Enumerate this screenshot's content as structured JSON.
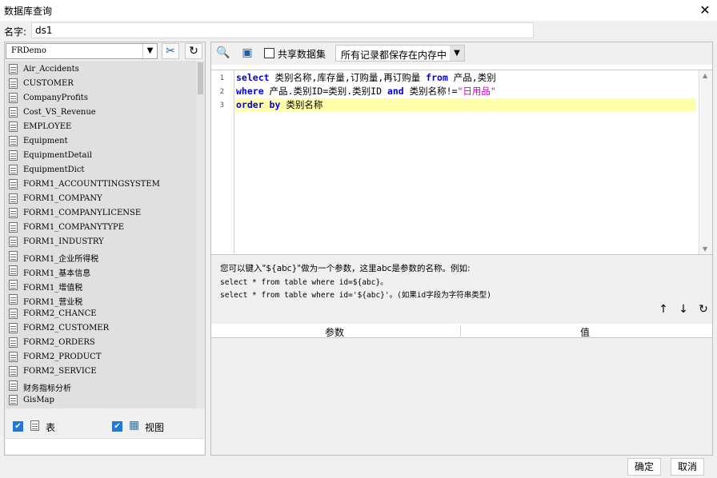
{
  "window": {
    "title": "数据库查询",
    "close_glyph": "✕"
  },
  "name_field": {
    "label": "名字:",
    "value": "ds1"
  },
  "left": {
    "db_select": "FRDemo",
    "tables": [
      "Air_Accidents",
      "CUSTOMER",
      "CompanyProfits",
      "Cost_VS_Revenue",
      "EMPLOYEE",
      "Equipment",
      "EquipmentDetail",
      "EquipmentDict",
      "FORM1_ACCOUNTTINGSYSTEM",
      "FORM1_COMPANY",
      "FORM1_COMPANYLICENSE",
      "FORM1_COMPANYTYPE",
      "FORM1_INDUSTRY",
      "FORM1_企业所得税",
      "FORM1_基本信息",
      "FORM1_增值税",
      "FORM1_营业税",
      "FORM2_CHANCE",
      "FORM2_CUSTOMER",
      "FORM2_ORDERS",
      "FORM2_PRODUCT",
      "FORM2_SERVICE",
      "财务指标分析",
      "GisMap"
    ],
    "check_table_label": "表",
    "check_view_label": "视图"
  },
  "toolbar": {
    "share_label": "共享数据集",
    "mem_select": "所有记录都保存在内存中"
  },
  "editor": {
    "lines": [
      {
        "num": "1",
        "parts": [
          [
            "kw",
            "select"
          ],
          [
            "t",
            " 类别名称,库存量,订购量,再订购量 "
          ],
          [
            "kw",
            "from"
          ],
          [
            "t",
            " 产品,类别"
          ]
        ]
      },
      {
        "num": "2",
        "parts": [
          [
            "kw",
            "where"
          ],
          [
            "t",
            " 产品.类别ID=类别.类别ID "
          ],
          [
            "kw",
            "and"
          ],
          [
            "t",
            " 类别名称!="
          ],
          [
            "str",
            "\"日用品\""
          ]
        ]
      },
      {
        "num": "3",
        "parts": [
          [
            "kw",
            "order by"
          ],
          [
            "t",
            " 类别名称"
          ]
        ]
      }
    ]
  },
  "hint": {
    "line1": "您可以键入\"${abc}\"做为一个参数，这里abc是参数的名称。例如:",
    "line2": "select * from table where id=${abc}。",
    "line3": "select * from table where id='${abc}'。(如果id字段为字符串类型)"
  },
  "params": {
    "col_param": "参数",
    "col_value": "值"
  },
  "buttons": {
    "ok": "确定",
    "cancel": "取消"
  }
}
